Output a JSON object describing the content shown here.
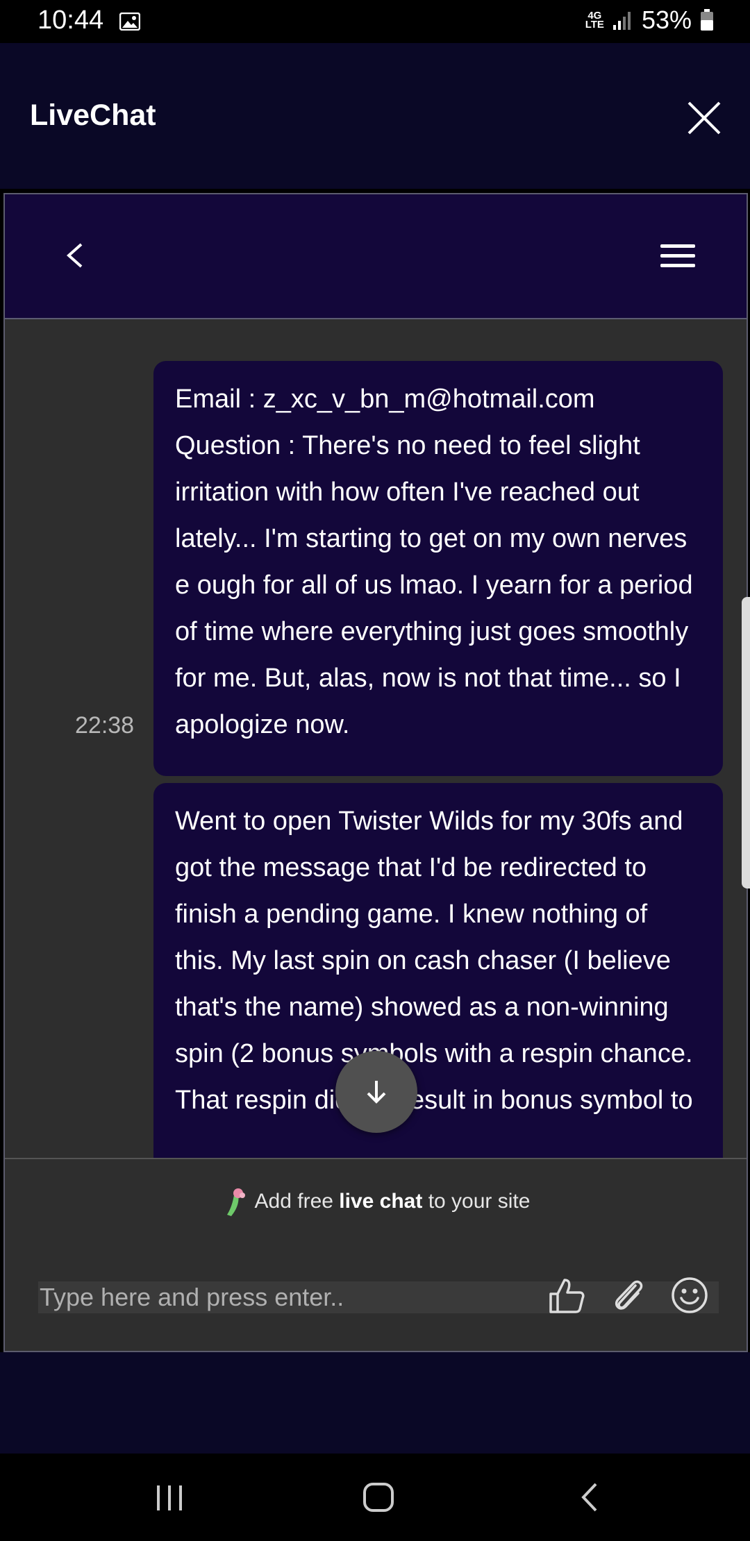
{
  "status_bar": {
    "time": "10:44",
    "network": "4G LTE",
    "battery": "53%",
    "icons": [
      "image-icon",
      "signal-icon",
      "battery-icon"
    ]
  },
  "header": {
    "title": "LiveChat",
    "close_icon": "close-icon"
  },
  "chat_toolbar": {
    "back_icon": "chevron-left-icon",
    "menu_icon": "hamburger-menu-icon"
  },
  "messages": [
    {
      "text": "Email : z_xc_v_bn_m@hotmail.com Question : There's no need to feel slight irritation with how often I've reached out lately... I'm starting to get on my own nerves e ough for all of us lmao. I yearn for a period of time where everything just goes smoothly for me. But, alas, now is not that time... so I apologize now.",
      "time": "22:38"
    },
    {
      "text": "Went to open Twister Wilds for my 30fs and got the message that I'd be redirected to finish a pending game. I knew nothing of this. My last spin on cash chaser (I believe that's the name) showed as a non-winning spin (2 bonus symbols with a respin chance. That respin did not result in bonus symbol to"
    }
  ],
  "promo": {
    "prefix": "Add free ",
    "bold": "live chat",
    "suffix": " to your site"
  },
  "composer": {
    "placeholder": "Type here and press enter..",
    "icons": [
      "thumbs-up-icon",
      "paperclip-icon",
      "smiley-icon"
    ]
  },
  "colors": {
    "header_bg": "#0a0826",
    "bubble_bg": "#13073a",
    "chat_bg": "#2e2e2e"
  }
}
